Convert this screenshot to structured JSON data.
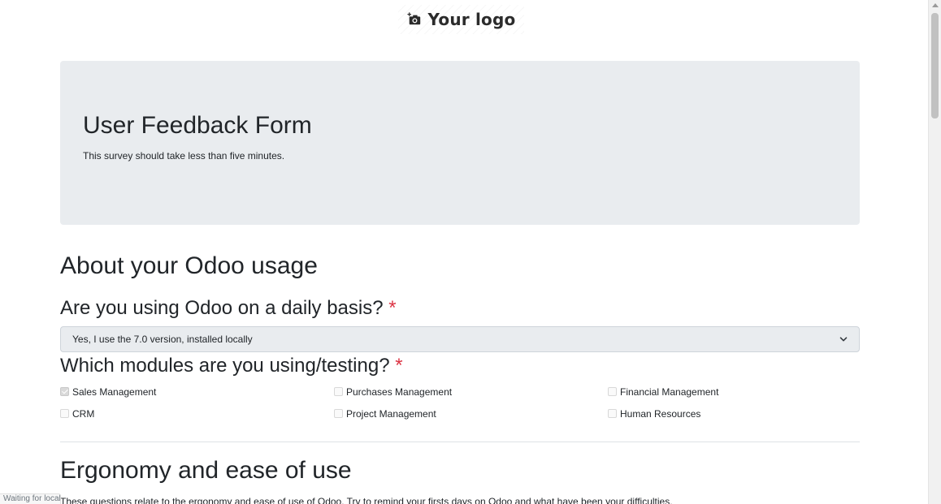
{
  "logo": {
    "text": "Your logo",
    "icon": "camera-plus-icon"
  },
  "hero": {
    "title": "User Feedback Form",
    "subtitle": "This survey should take less than five minutes."
  },
  "section1": {
    "title": "About your Odoo usage"
  },
  "question1": {
    "title": "Are you using Odoo on a daily basis?",
    "required_mark": "*",
    "selected_value": "Yes, I use the 7.0 version, installed locally"
  },
  "question2": {
    "title": "Which modules are you using/testing?",
    "required_mark": "*",
    "options": [
      {
        "label": "Sales Management",
        "checked": true
      },
      {
        "label": "Purchases Management",
        "checked": false
      },
      {
        "label": "Financial Management",
        "checked": false
      },
      {
        "label": "CRM",
        "checked": false
      },
      {
        "label": "Project Management",
        "checked": false
      },
      {
        "label": "Human Resources",
        "checked": false
      }
    ]
  },
  "section2": {
    "title": "Ergonomy and ease of use",
    "description": "These questions relate to the ergonomy and ease of use of Odoo. Try to remind your firsts days on Odoo and what have been your difficulties."
  },
  "status": {
    "text": "Waiting for localhost..."
  },
  "colors": {
    "required": "#dc3545",
    "hero_bg": "#e9ecef",
    "text": "#212529"
  }
}
